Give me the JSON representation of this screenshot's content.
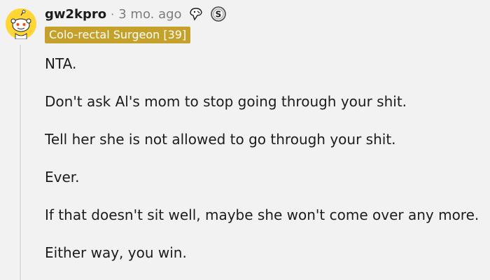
{
  "comment": {
    "username": "gw2kpro",
    "separator": "·",
    "timestamp": "3 mo. ago",
    "flair": "Colo-rectal Surgeon [39]",
    "awards": [
      {
        "icon": "wholesome-seal-award-icon"
      },
      {
        "icon": "silver-coin-award-icon",
        "glyph": "S"
      }
    ],
    "paragraphs": [
      "NTA.",
      "Don't ask Al's mom to stop going through your shit.",
      "Tell her she is not allowed to go through your shit.",
      "Ever.",
      "If that doesn't sit well, maybe she won't come over any more.",
      "Either way, you win."
    ]
  },
  "colors": {
    "background": "#f2f2f2",
    "avatar": "#ffd635",
    "flair_bg": "#c5a02b",
    "flair_text": "#ffffff",
    "meta_text": "#7c7c7c",
    "thread_line": "#dcdcdc"
  }
}
